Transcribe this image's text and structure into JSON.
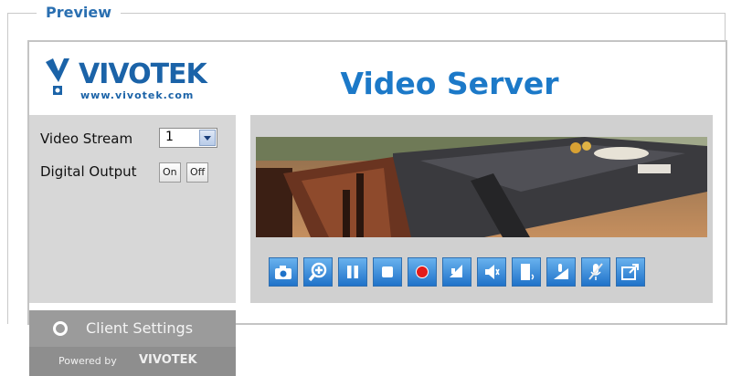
{
  "legend": "Preview",
  "logo": {
    "brand": "VIVOTEK",
    "url": "www.vivotek.com"
  },
  "title": "Video Server",
  "controls": {
    "video_stream_label": "Video Stream",
    "video_stream_value": "1",
    "digital_output_label": "Digital Output",
    "on_label": "On",
    "off_label": "Off"
  },
  "client_settings": "Client Settings",
  "powered": {
    "text": "Powered by",
    "brand": "VIVOTEK"
  },
  "toolbar": {
    "buttons": [
      {
        "icon": "camera-icon"
      },
      {
        "icon": "zoom-in-icon"
      },
      {
        "icon": "pause-icon"
      },
      {
        "icon": "stop-icon"
      },
      {
        "icon": "record-icon"
      },
      {
        "icon": "volume-icon"
      },
      {
        "icon": "mute-icon"
      },
      {
        "icon": "talk-icon"
      },
      {
        "icon": "microphone-volume-icon"
      },
      {
        "icon": "microphone-mute-icon"
      },
      {
        "icon": "fullscreen-icon"
      }
    ]
  },
  "colors": {
    "accent": "#1c79c8",
    "panel": "#d7d7d7",
    "button": "#1f72c9"
  }
}
